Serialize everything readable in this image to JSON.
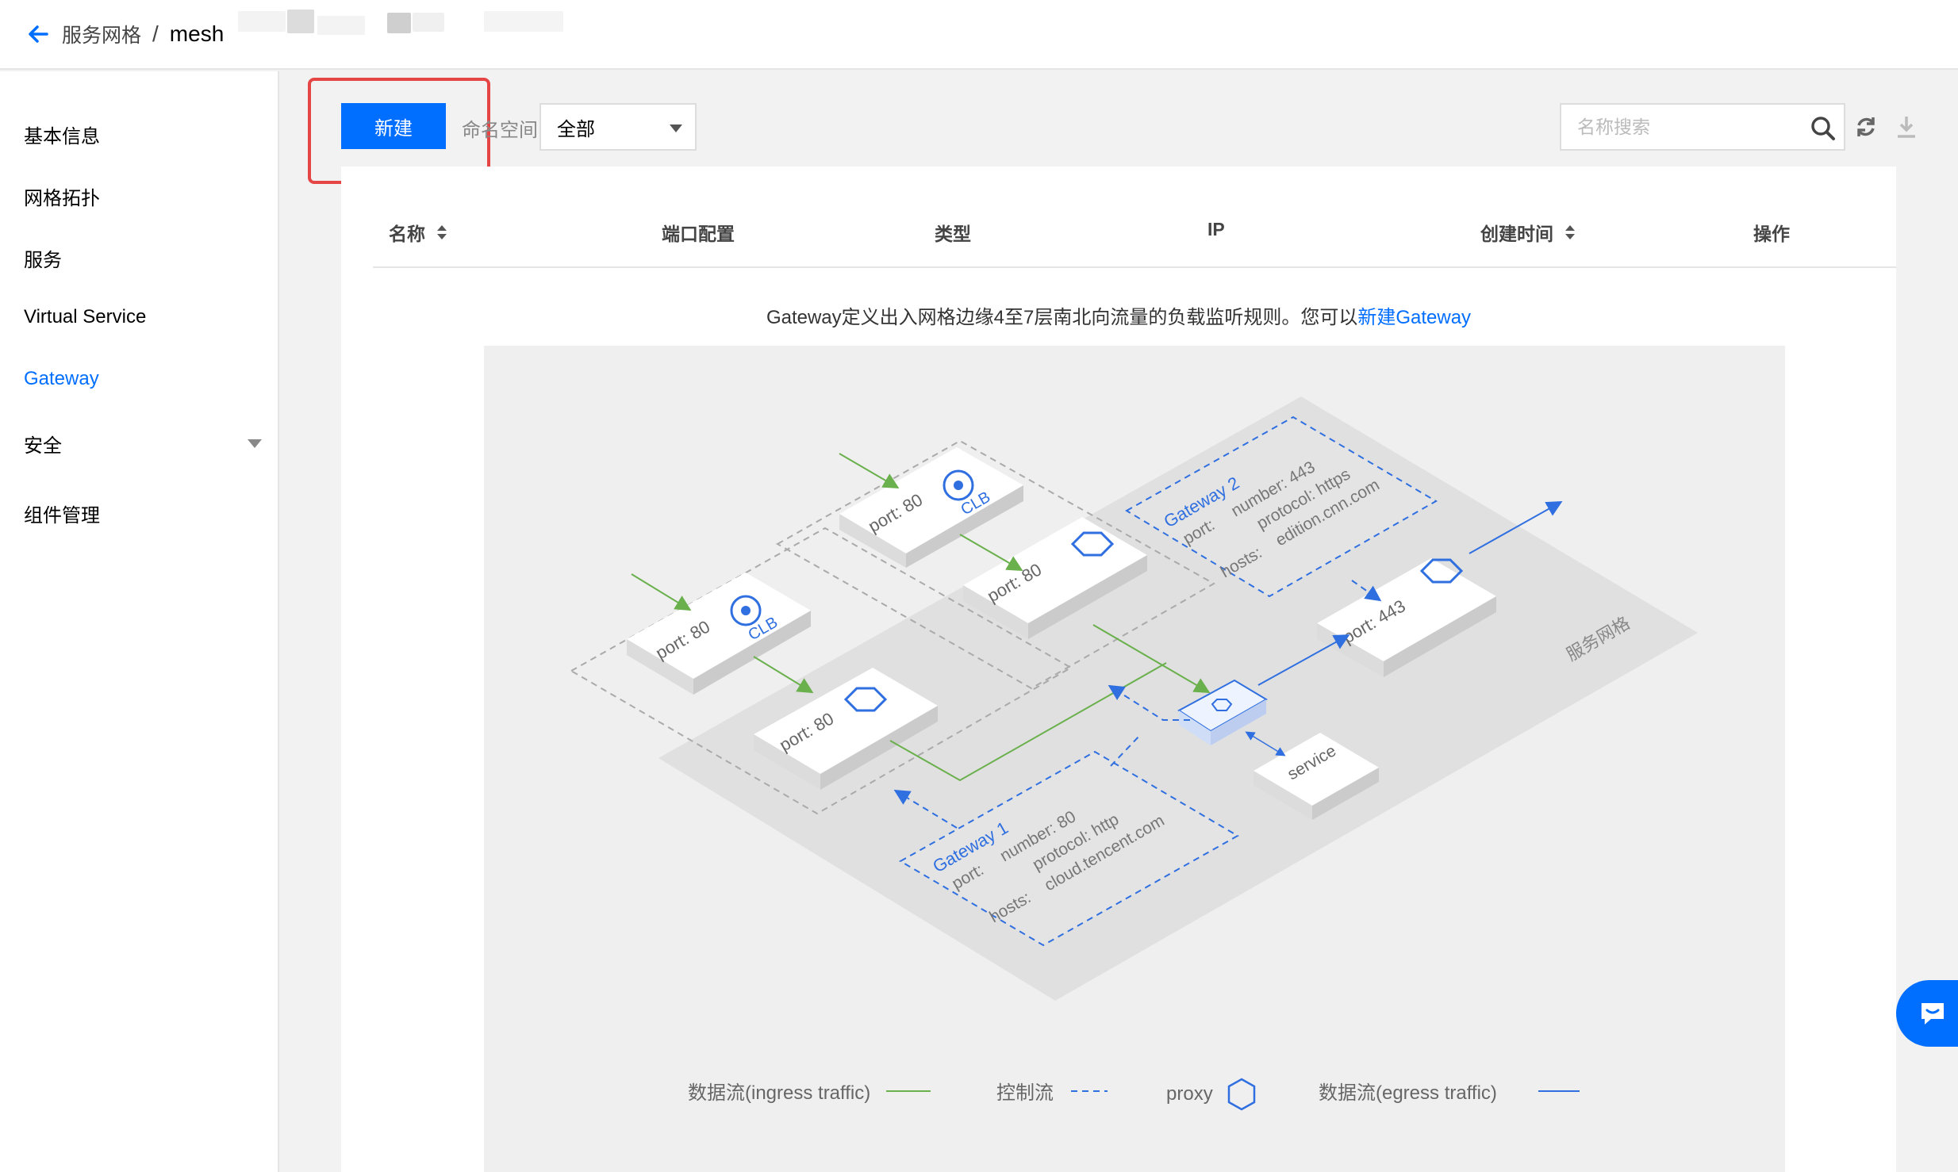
{
  "header": {
    "breadcrumb_parent": "服务网格",
    "breadcrumb_separator": "/",
    "breadcrumb_current": "mesh"
  },
  "sidebar": {
    "items": [
      {
        "label": "基本信息"
      },
      {
        "label": "网格拓扑"
      },
      {
        "label": "服务"
      },
      {
        "label": "Virtual Service"
      },
      {
        "label": "Gateway",
        "active": true
      },
      {
        "label": "安全",
        "expandable": true
      },
      {
        "label": "组件管理"
      }
    ]
  },
  "toolbar": {
    "new_label": "新建",
    "namespace_label": "命名空间",
    "namespace_value": "全部",
    "search_placeholder": "名称搜索"
  },
  "table": {
    "columns": [
      "名称",
      "端口配置",
      "类型",
      "IP",
      "创建时间",
      "操作"
    ]
  },
  "empty_state": {
    "text": "Gateway定义出入网格边缘4至7层南北向流量的负载监听规则。您可以",
    "link": "新建Gateway"
  },
  "diagram": {
    "clb_1": "CLB",
    "clb_2": "CLB",
    "port_80": "port: 80",
    "port_443": "port: 443",
    "service": "service",
    "mesh_label": "服务网格",
    "gateway1": {
      "title": "Gateway 1",
      "port": "port:",
      "number": "number: 80",
      "protocol": "protocol: http",
      "hosts": "hosts:",
      "host_value": "cloud.tencent.com"
    },
    "gateway2": {
      "title": "Gateway 2",
      "port": "port:",
      "number": "number: 443",
      "protocol": "protocol: https",
      "hosts": "hosts:",
      "host_value": "edition.cnn.com"
    }
  },
  "legend": {
    "ingress": "数据流(ingress traffic)",
    "control": "控制流",
    "proxy": "proxy",
    "egress": "数据流(egress traffic)"
  },
  "colors": {
    "primary": "#006eff",
    "ingress": "#6ab04c",
    "highlight": "#e54545"
  }
}
